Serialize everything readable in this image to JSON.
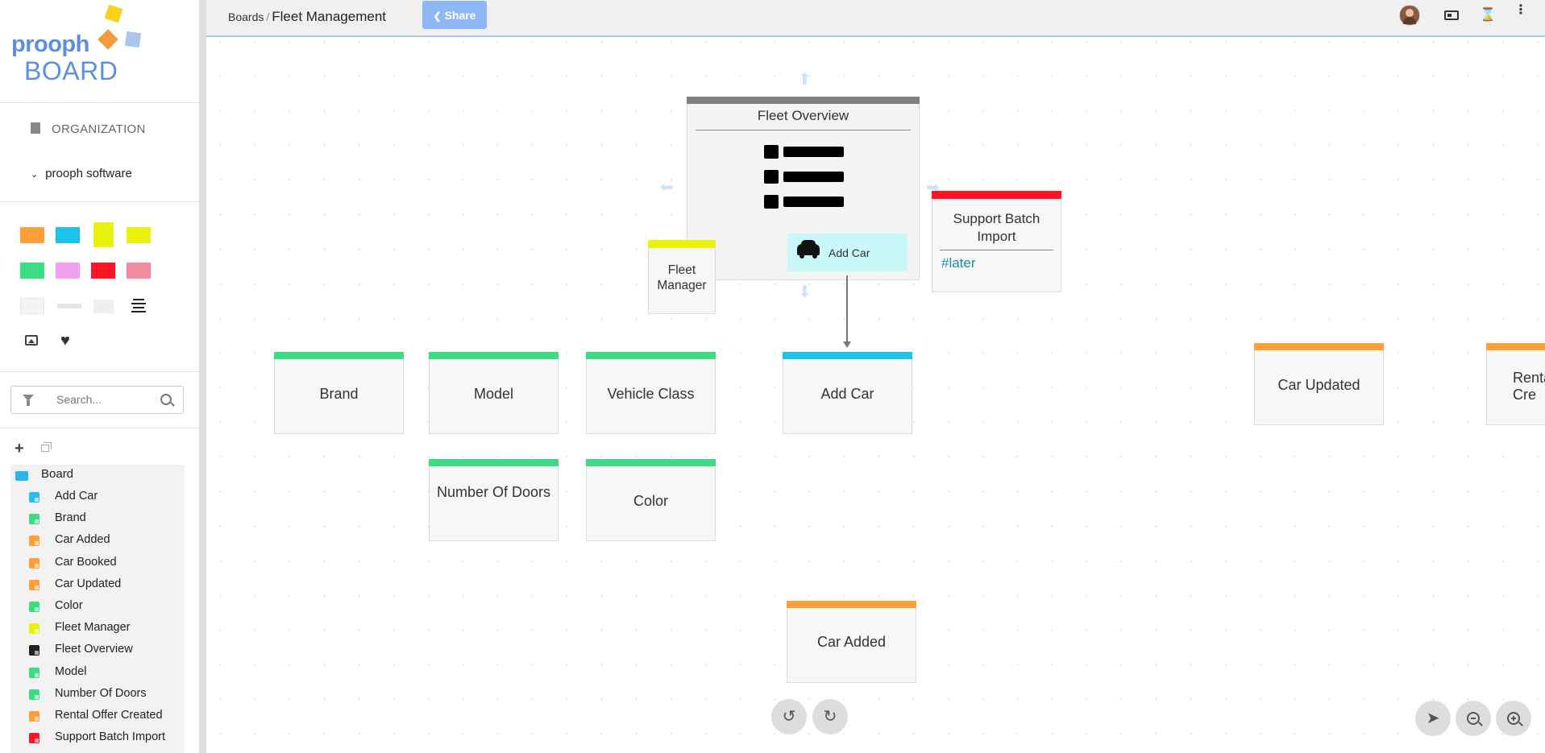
{
  "logo": {
    "line1": "prooph",
    "line2": "BOARD"
  },
  "sidebar": {
    "organization_label": "ORGANIZATION",
    "project_label": "prooph software",
    "search_placeholder": "Search...",
    "tree_root": "Board",
    "items": [
      {
        "label": "Add Car",
        "color": "#2bbce8"
      },
      {
        "label": "Brand",
        "color": "#3ddc84"
      },
      {
        "label": "Car Added",
        "color": "#ff9e3b"
      },
      {
        "label": "Car Booked",
        "color": "#ff9e3b"
      },
      {
        "label": "Car Updated",
        "color": "#ff9e3b"
      },
      {
        "label": "Color",
        "color": "#3ddc84"
      },
      {
        "label": "Fleet Manager",
        "color": "#e8f20a"
      },
      {
        "label": "Fleet Overview",
        "color": "#222222"
      },
      {
        "label": "Model",
        "color": "#3ddc84"
      },
      {
        "label": "Number Of Doors",
        "color": "#3ddc84"
      },
      {
        "label": "Rental Offer Created",
        "color": "#ff9e3b"
      },
      {
        "label": "Support Batch Import",
        "color": "#ff1324"
      }
    ]
  },
  "topbar": {
    "breadcrumb_root": "Boards",
    "breadcrumb_sep": "/",
    "board_title": "Fleet Management",
    "share_label": "Share"
  },
  "canvas": {
    "fleet_overview": {
      "title": "Fleet Overview",
      "button_label": "Add Car"
    },
    "support_batch": {
      "title": "Support Batch Import",
      "tag": "#later"
    },
    "fleet_manager": {
      "title": "Fleet Manager"
    },
    "cards": {
      "brand": "Brand",
      "model": "Model",
      "vehicle_class": "Vehicle Class",
      "add_car": "Add Car",
      "number_of_doors": "Number Of Doors",
      "color": "Color",
      "car_updated": "Car Updated",
      "rental_offer": "Renta Cre",
      "car_added": "Car Added"
    }
  },
  "colors": {
    "command": "#2bbce8",
    "aggregate_info": "#3ddc84",
    "event": "#ff9e3b",
    "role": "#e8f20a",
    "hotspot": "#ff1324",
    "ui": "#808080",
    "accent": "#5b8fe0"
  }
}
